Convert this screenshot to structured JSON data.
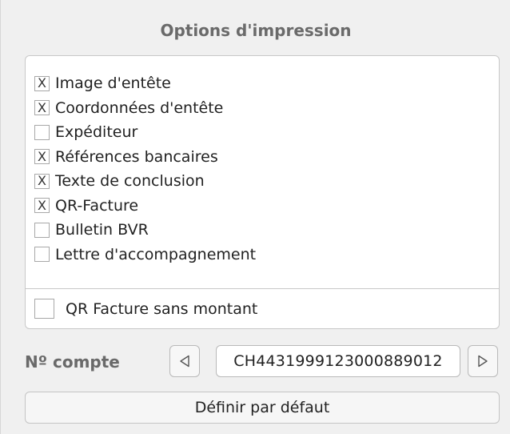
{
  "panel": {
    "title": "Options d'impression"
  },
  "options": [
    {
      "label": "Image d'entête",
      "checked": true,
      "mark": "X"
    },
    {
      "label": "Coordonnées d'entête",
      "checked": true,
      "mark": "X"
    },
    {
      "label": "Expéditeur",
      "checked": false,
      "mark": ""
    },
    {
      "label": "Références bancaires",
      "checked": true,
      "mark": "X"
    },
    {
      "label": "Texte de conclusion",
      "checked": true,
      "mark": "X"
    },
    {
      "label": "QR-Facture",
      "checked": true,
      "mark": "X"
    },
    {
      "label": "Bulletin BVR",
      "checked": false,
      "mark": ""
    },
    {
      "label": "Lettre d'accompagnement",
      "checked": false,
      "mark": ""
    }
  ],
  "qr_no_amount": {
    "label": "QR Facture sans montant",
    "checked": false
  },
  "account": {
    "label": "Nº compte",
    "value": "CH4431999123000889012",
    "prev_icon": "triangle-left-icon",
    "next_icon": "triangle-right-icon"
  },
  "default_button": {
    "label": "Définir par défaut"
  }
}
